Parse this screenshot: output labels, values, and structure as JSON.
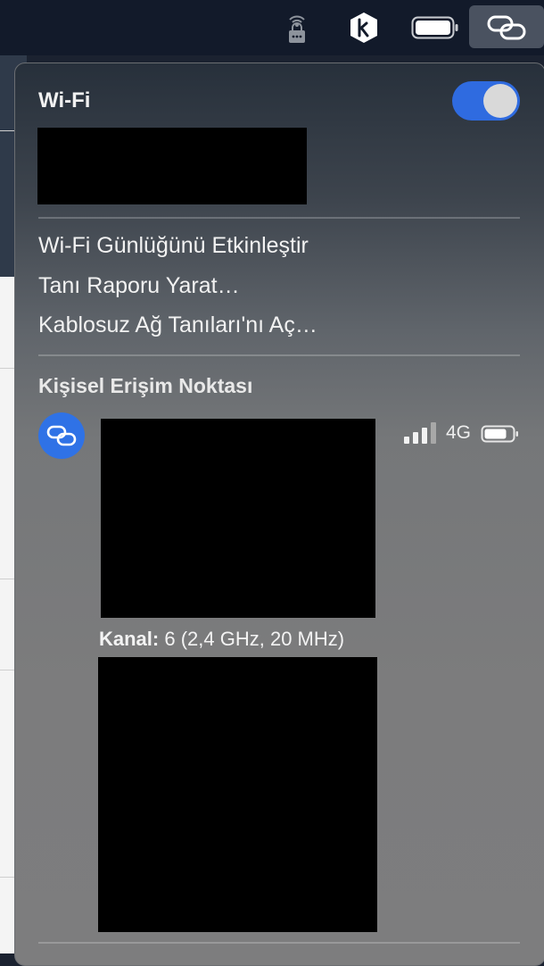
{
  "menubar": {
    "icons": [
      "vpn-lock-icon",
      "keybase-icon",
      "battery-icon",
      "personal-hotspot-icon"
    ]
  },
  "panel": {
    "title": "Wi-Fi",
    "wifi_enabled": true,
    "menu_items": [
      "Wi-Fi Günlüğünü Etkinleştir",
      "Tanı Raporu Yarat…",
      "Kablosuz Ağ Tanıları'nı Aç…"
    ],
    "section_title": "Kişisel Erişim Noktası",
    "hotspot": {
      "network_type": "4G",
      "signal_bars": 3,
      "signal_bars_total": 4,
      "channel_label": "Kanal:",
      "channel_value": "6 (2,4 GHz, 20 MHz)"
    }
  },
  "colors": {
    "accent": "#2f6be0",
    "hotspot_icon_bg": "#2f72e6",
    "menubar_bg": "#121a2a"
  }
}
